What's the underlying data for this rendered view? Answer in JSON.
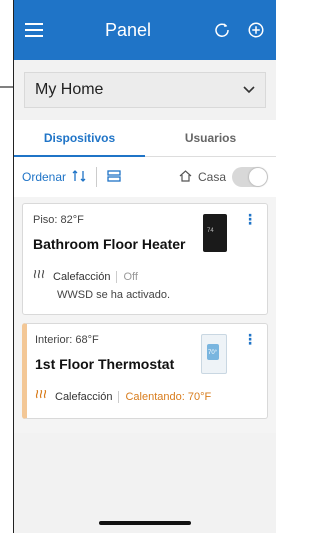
{
  "header": {
    "title": "Panel"
  },
  "home": {
    "selected": "My Home"
  },
  "tabs": [
    {
      "label": "Dispositivos"
    },
    {
      "label": "Usuarios"
    }
  ],
  "toolbar": {
    "sort_label": "Ordenar",
    "casa_label": "Casa"
  },
  "devices": [
    {
      "reading": "Piso: 82°F",
      "name": "Bathroom Floor Heater",
      "mode": "Calefacción",
      "state": "Off",
      "note": "WWSD se ha activado."
    },
    {
      "reading": "Interior: 68°F",
      "name": "1st Floor Thermostat",
      "mode": "Calefacción",
      "state": "Calentando: 70°F"
    }
  ],
  "colors": {
    "primary": "#1f74c7",
    "heating": "#d87c1c"
  },
  "icons": [
    "menu-icon",
    "refresh-icon",
    "add-icon",
    "chevron-down-icon",
    "sort-icon",
    "layout-icon",
    "home-icon",
    "heat-icon",
    "more-vert-icon"
  ]
}
